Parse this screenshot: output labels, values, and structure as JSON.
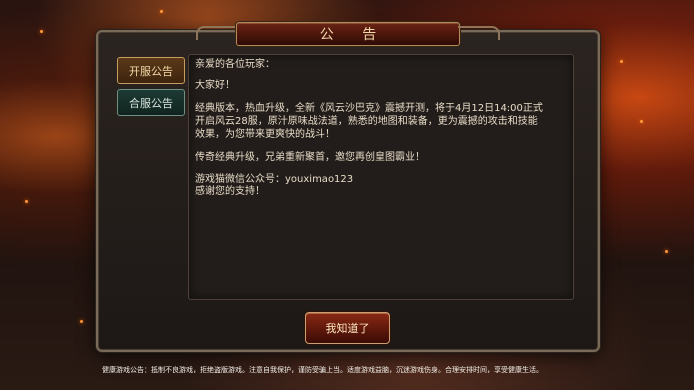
{
  "dialog": {
    "title": "公 告",
    "tabs": [
      {
        "label": "开服公告",
        "active": true
      },
      {
        "label": "合服公告",
        "active": false
      }
    ],
    "content": {
      "greeting": "亲爱的各位玩家：",
      "hello": "大家好！",
      "para1_line1": "经典版本，热血升级，全新《风云沙巴克》震撼开测，将于4月12日14:00正式",
      "para1_line2": "开启风云28服，原汁原味战法道，熟悉的地图和装备，更为震撼的攻击和技能",
      "para1_line3": "效果，为您带来更爽快的战斗！",
      "para2": "传奇经典升级，兄弟重新聚首，邀您再创皇图霸业！",
      "wechat": "游戏猫微信公众号：youximao123",
      "thanks": "感谢您的支持！"
    },
    "confirm_label": "我知道了"
  },
  "health_notice": "健康游戏公告：抵制不良游戏，拒绝盗版游戏。注意自我保护，谨防受骗上当。适度游戏益脑，沉迷游戏伤身。合理安排时间，享受健康生活。",
  "colors": {
    "panel_border": "#7a6a58",
    "title_plate": "#4a150b",
    "active_tab": "#3e240e",
    "inactive_tab": "#10241f",
    "button": "#5a160a",
    "text": "#e8dcc8"
  }
}
